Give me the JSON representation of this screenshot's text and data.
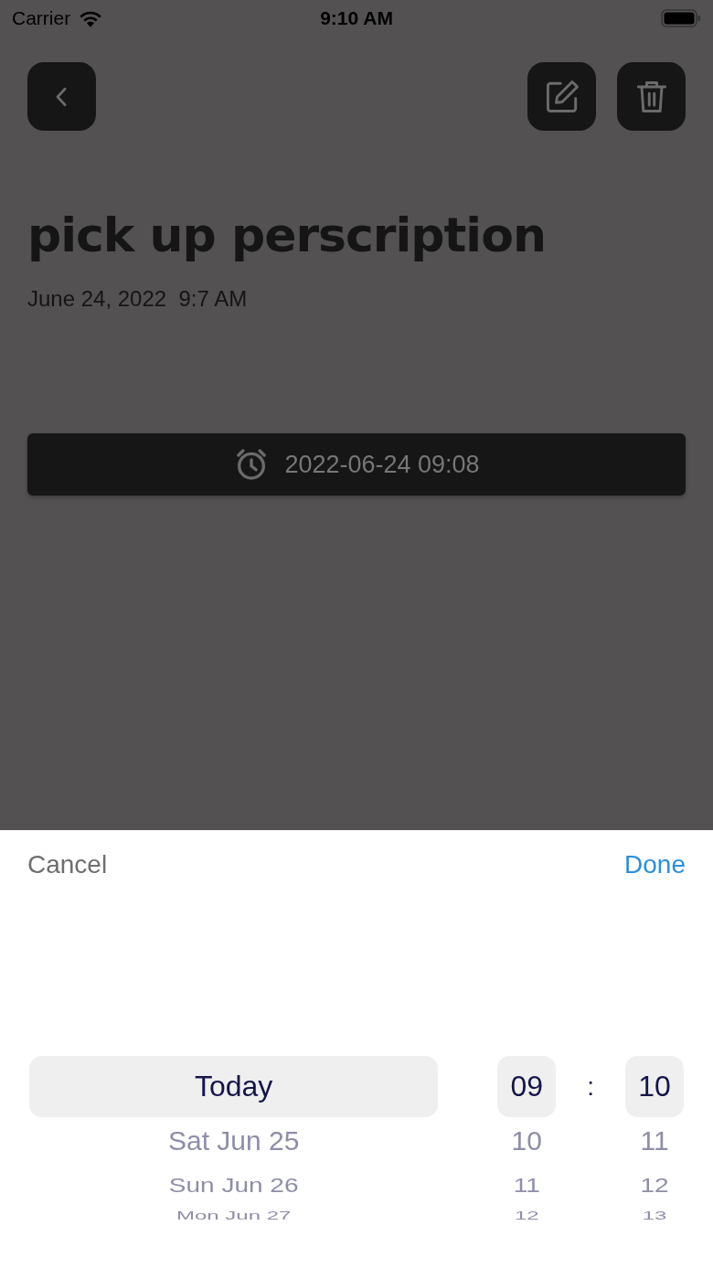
{
  "status_bar": {
    "carrier": "Carrier",
    "time": "9:10 AM"
  },
  "note": {
    "title": "pick up perscription",
    "date": "June 24, 2022  9:7 AM",
    "reminder": "2022-06-24 09:08"
  },
  "sheet": {
    "cancel": "Cancel",
    "done": "Done"
  },
  "picker": {
    "date": [
      {
        "label": "Today",
        "selected": true
      },
      {
        "label": "Sat Jun 25",
        "selected": false
      },
      {
        "label": "Sun Jun 26",
        "selected": false
      },
      {
        "label": "Mon Jun 27",
        "selected": false
      }
    ],
    "separator": ":",
    "hour": [
      {
        "label": "09",
        "selected": true
      },
      {
        "label": "10",
        "selected": false
      },
      {
        "label": "11",
        "selected": false
      },
      {
        "label": "12",
        "selected": false
      }
    ],
    "minute": [
      {
        "label": "10",
        "selected": true
      },
      {
        "label": "11",
        "selected": false
      },
      {
        "label": "12",
        "selected": false
      },
      {
        "label": "13",
        "selected": false
      }
    ]
  }
}
